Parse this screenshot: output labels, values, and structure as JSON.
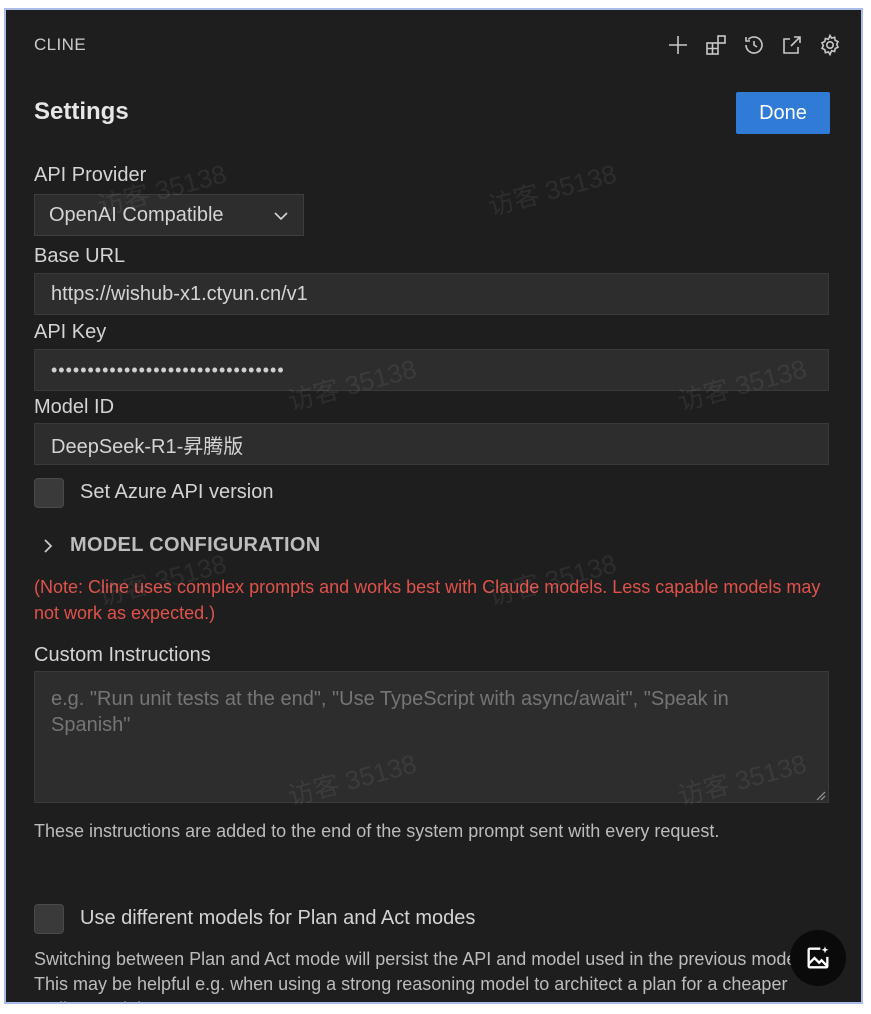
{
  "panel": {
    "title": "CLINE"
  },
  "header_icons": [
    "plus-icon",
    "extensions-icon",
    "history-icon",
    "popout-icon",
    "gear-icon"
  ],
  "settings": {
    "title": "Settings",
    "done_label": "Done",
    "api_provider": {
      "label": "API Provider",
      "value": "OpenAI Compatible"
    },
    "base_url": {
      "label": "Base URL",
      "value": "https://wishub-x1.ctyun.cn/v1"
    },
    "api_key": {
      "label": "API Key",
      "masked_value": "••••••••••••••••••••••••••••••••"
    },
    "model_id": {
      "label": "Model ID",
      "value": "DeepSeek-R1-昇腾版"
    },
    "azure_checkbox": {
      "label": "Set Azure API version",
      "checked": false
    },
    "model_config": {
      "label": "MODEL CONFIGURATION",
      "expanded": false
    },
    "note": "(Note: Cline uses complex prompts and works best with Claude models. Less capable models may not work as expected.)",
    "custom_instructions": {
      "label": "Custom Instructions",
      "placeholder": "e.g. \"Run unit tests at the end\", \"Use TypeScript with async/await\", \"Speak in Spanish\"",
      "helper": "These instructions are added to the end of the system prompt sent with every request."
    },
    "plan_act_checkbox": {
      "label": "Use different models for Plan and Act modes",
      "checked": false
    },
    "plan_act_helper": "Switching between Plan and Act mode will persist the API and model used in the previous mode. This may be helpful e.g. when using a strong reasoning model to architect a plan for a cheaper coding model to act on."
  },
  "watermark": "访客 35138",
  "colors": {
    "background": "#1e1e1e",
    "accent": "#2f7bd6",
    "note": "#e0524a"
  }
}
